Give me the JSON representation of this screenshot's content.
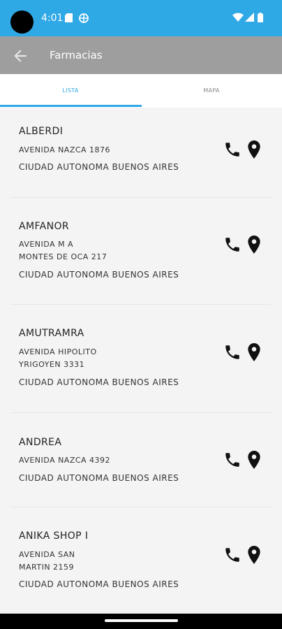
{
  "status_bar": {
    "time": "4:01",
    "icons": [
      "sd-card-icon",
      "vpn-globe-icon",
      "wifi-icon",
      "signal-icon",
      "battery-icon"
    ]
  },
  "app_bar": {
    "title": "Farmacias",
    "back_icon": "arrow-left-icon",
    "background": "#9e9e9e"
  },
  "tabs": [
    {
      "label": "LISTA",
      "active": true
    },
    {
      "label": "MAPA",
      "active": false
    }
  ],
  "accent_color": "#2fa8e6",
  "pharmacies": [
    {
      "name": "ALBERDI",
      "address_lines": [
        "AVENIDA NAZCA 1876"
      ],
      "city": "CIUDAD AUTONOMA BUENOS AIRES"
    },
    {
      "name": "AMFANOR",
      "address_lines": [
        "AVENIDA M A",
        "MONTES DE OCA 217"
      ],
      "city": "CIUDAD AUTONOMA BUENOS AIRES"
    },
    {
      "name": "AMUTRAMRA",
      "address_lines": [
        "AVENIDA HIPOLITO",
        "YRIGOYEN 3331"
      ],
      "city": "CIUDAD AUTONOMA BUENOS AIRES"
    },
    {
      "name": "ANDREA",
      "address_lines": [
        "AVENIDA NAZCA 4392"
      ],
      "city": "CIUDAD AUTONOMA BUENOS AIRES"
    },
    {
      "name": "ANIKA SHOP I",
      "address_lines": [
        "AVENIDA SAN",
        "MARTIN 2159"
      ],
      "city": "CIUDAD AUTONOMA BUENOS AIRES"
    }
  ],
  "item_actions": [
    "phone-icon",
    "location-pin-icon"
  ]
}
